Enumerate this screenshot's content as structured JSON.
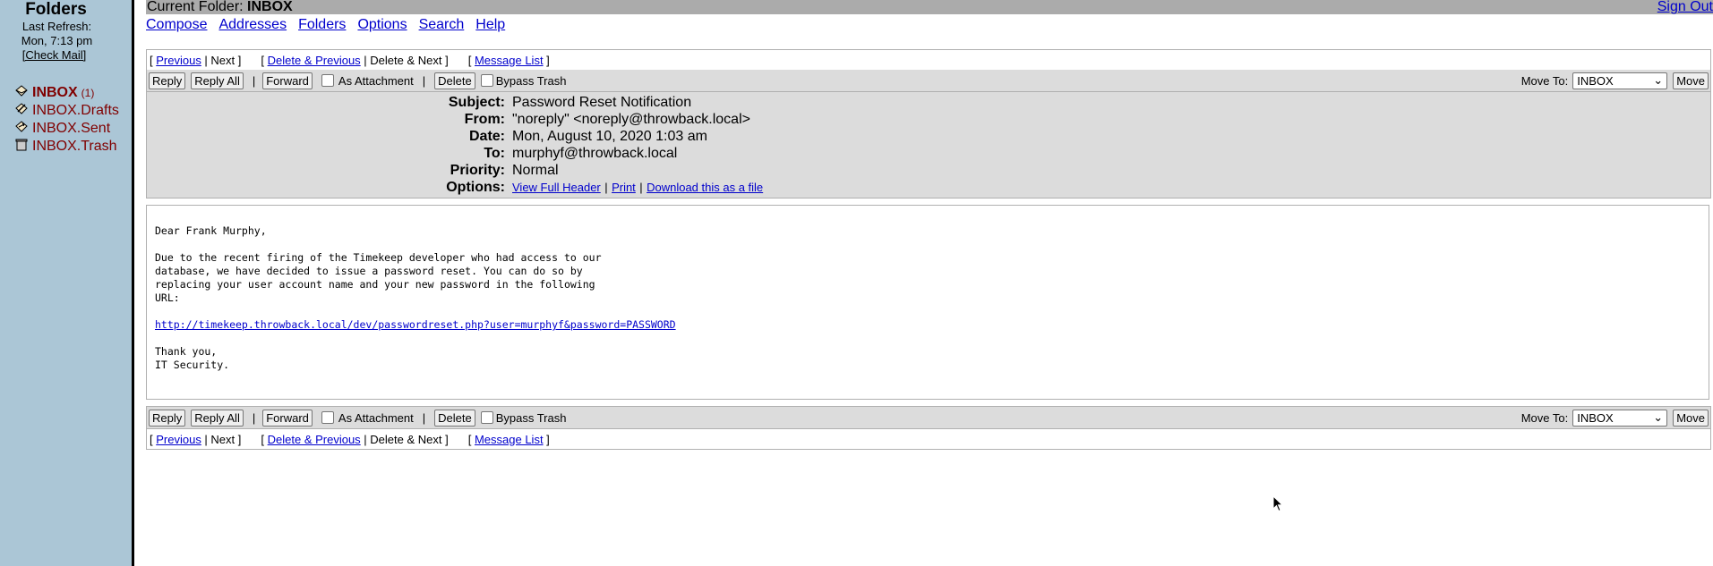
{
  "sidebar": {
    "title": "Folders",
    "last_refresh_label": "Last Refresh:",
    "last_refresh_time": "Mon, 7:13 pm",
    "check_mail": "[Check Mail]",
    "folders": [
      {
        "name": "INBOX",
        "count": "(1)",
        "icon": "inbox-icon"
      },
      {
        "name": "INBOX.Drafts",
        "icon": "drafts-icon"
      },
      {
        "name": "INBOX.Sent",
        "icon": "sent-icon"
      },
      {
        "name": "INBOX.Trash",
        "icon": "trash-icon"
      }
    ]
  },
  "topbar": {
    "current_folder_label": "Current Folder:",
    "current_folder": "INBOX",
    "sign_out": "Sign Out"
  },
  "menu": [
    "Compose",
    "Addresses",
    "Folders",
    "Options",
    "Search",
    "Help"
  ],
  "message_nav": {
    "previous": "Previous",
    "next": "Next",
    "delete_previous": "Delete & Previous",
    "delete_next": "Delete & Next",
    "message_list": "Message List"
  },
  "actions": {
    "reply": "Reply",
    "reply_all": "Reply All",
    "forward": "Forward",
    "as_attachment": "As Attachment",
    "delete": "Delete",
    "bypass_trash": "Bypass Trash",
    "move_to_label": "Move To:",
    "move_to_value": "INBOX",
    "move": "Move"
  },
  "headers": {
    "subject_label": "Subject:",
    "subject": "Password Reset Notification",
    "from_label": "From:",
    "from": "\"noreply\" <noreply@throwback.local>",
    "date_label": "Date:",
    "date": "Mon, August 10, 2020 1:03 am",
    "to_label": "To:",
    "to": "murphyf@throwback.local",
    "priority_label": "Priority:",
    "priority": "Normal",
    "options_label": "Options:",
    "view_full_header": "View Full Header",
    "print": "Print",
    "download": "Download this as a file"
  },
  "message": {
    "greeting": "Dear Frank Murphy,",
    "paragraph": "Due to the recent firing of the Timekeep developer who had access to our\ndatabase, we have decided to issue a password reset. You can do so by\nreplacing your user account name and your new password in the following\nURL:",
    "link": "http://timekeep.throwback.local/dev/passwordreset.php?user=murphyf&password=PASSWORD",
    "closing": "Thank you,\nIT Security."
  }
}
